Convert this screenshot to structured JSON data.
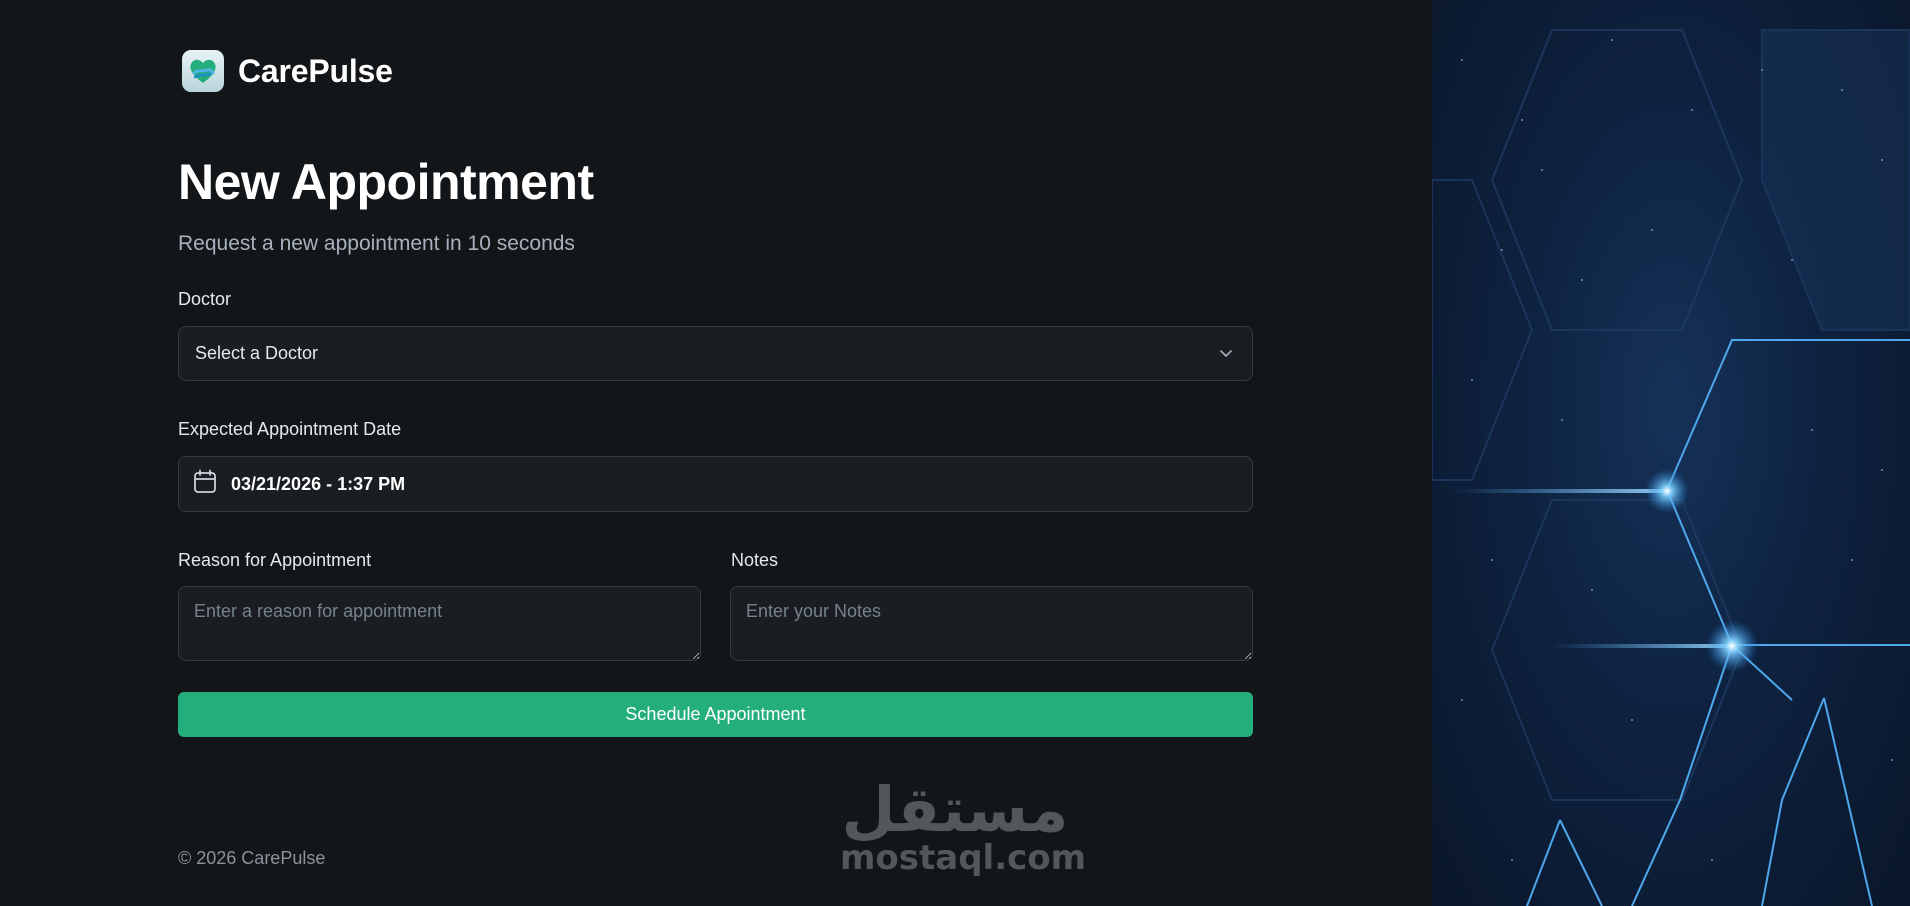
{
  "brand": {
    "name": "CarePulse"
  },
  "header": {
    "title": "New Appointment",
    "subtitle": "Request a new appointment in 10 seconds"
  },
  "form": {
    "doctor": {
      "label": "Doctor",
      "value": "Select a Doctor"
    },
    "date": {
      "label": "Expected Appointment Date",
      "value": "03/21/2026 - 1:37 PM"
    },
    "reason": {
      "label": "Reason for Appointment",
      "placeholder": "Enter a reason for appointment"
    },
    "notes": {
      "label": "Notes",
      "placeholder": "Enter your Notes"
    },
    "submit_label": "Schedule Appointment"
  },
  "footer": {
    "copyright": "© 2026 CarePulse"
  },
  "watermark": {
    "arabic": "مستقل",
    "latin": "mostaql.com"
  },
  "colors": {
    "background": "#131619",
    "field_background": "#1a1d21",
    "field_border": "#363a3d",
    "accent_green": "#24ae7c",
    "panel_blue": "#0e2240",
    "glow_blue": "#5ab8ff"
  },
  "icons": {
    "logo": "heart-hands-logo-icon",
    "select": "chevron-down-icon",
    "date": "calendar-icon"
  }
}
